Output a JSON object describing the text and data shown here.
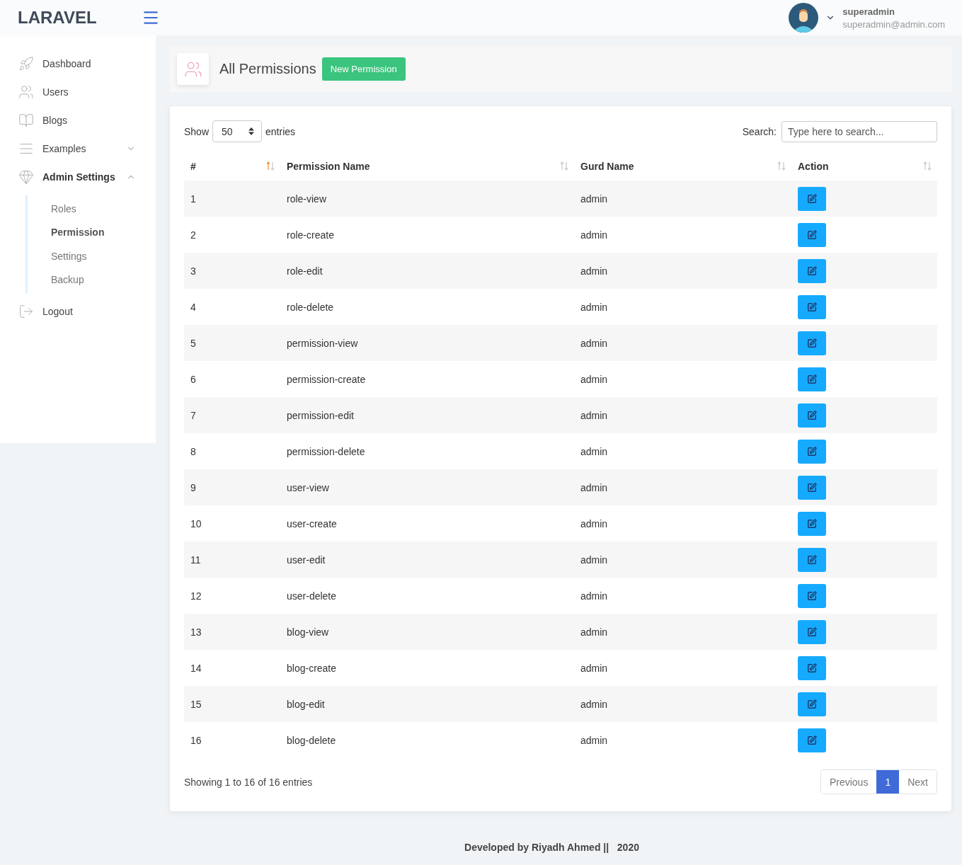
{
  "header": {
    "logo": "LARAVEL",
    "user": {
      "name": "superadmin",
      "email": "superadmin@admin.com"
    }
  },
  "sidebar": {
    "items": [
      {
        "label": "Dashboard",
        "selected": false
      },
      {
        "label": "Users",
        "selected": false
      },
      {
        "label": "Blogs",
        "selected": false
      },
      {
        "label": "Examples",
        "selected": false,
        "expanded": false
      },
      {
        "label": "Admin Settings",
        "selected": true,
        "expanded": true,
        "children": [
          {
            "label": "Roles",
            "selected": false
          },
          {
            "label": "Permission",
            "selected": true
          },
          {
            "label": "Settings",
            "selected": false
          },
          {
            "label": "Backup",
            "selected": false
          }
        ]
      },
      {
        "label": "Logout",
        "selected": false
      }
    ]
  },
  "page_title": {
    "title": "All Permissions",
    "button": "New Permission"
  },
  "table_controls": {
    "show_label": "Show",
    "page_size": "50",
    "entries_label": "entries",
    "search_label": "Search:",
    "search_placeholder": "Type here to search..."
  },
  "table": {
    "columns": [
      {
        "label": "#",
        "sorted": true
      },
      {
        "label": "Permission Name",
        "sorted": false
      },
      {
        "label": "Gurd Name",
        "sorted": false
      },
      {
        "label": "Action",
        "sorted": false
      }
    ],
    "rows": [
      [
        "1",
        "role-view",
        "admin"
      ],
      [
        "2",
        "role-create",
        "admin"
      ],
      [
        "3",
        "role-edit",
        "admin"
      ],
      [
        "4",
        "role-delete",
        "admin"
      ],
      [
        "5",
        "permission-view",
        "admin"
      ],
      [
        "6",
        "permission-create",
        "admin"
      ],
      [
        "7",
        "permission-edit",
        "admin"
      ],
      [
        "8",
        "permission-delete",
        "admin"
      ],
      [
        "9",
        "user-view",
        "admin"
      ],
      [
        "10",
        "user-create",
        "admin"
      ],
      [
        "11",
        "user-edit",
        "admin"
      ],
      [
        "12",
        "user-delete",
        "admin"
      ],
      [
        "13",
        "blog-view",
        "admin"
      ],
      [
        "14",
        "blog-create",
        "admin"
      ],
      [
        "15",
        "blog-edit",
        "admin"
      ],
      [
        "16",
        "blog-delete",
        "admin"
      ]
    ]
  },
  "table_footer": {
    "info": "Showing 1 to 16 of 16 entries",
    "pagination": [
      {
        "label": "Previous",
        "selected": false
      },
      {
        "label": "1",
        "selected": true
      },
      {
        "label": "Next",
        "selected": false
      }
    ]
  },
  "footer": "Developed by Riyadh Ahmed ||   2020"
}
